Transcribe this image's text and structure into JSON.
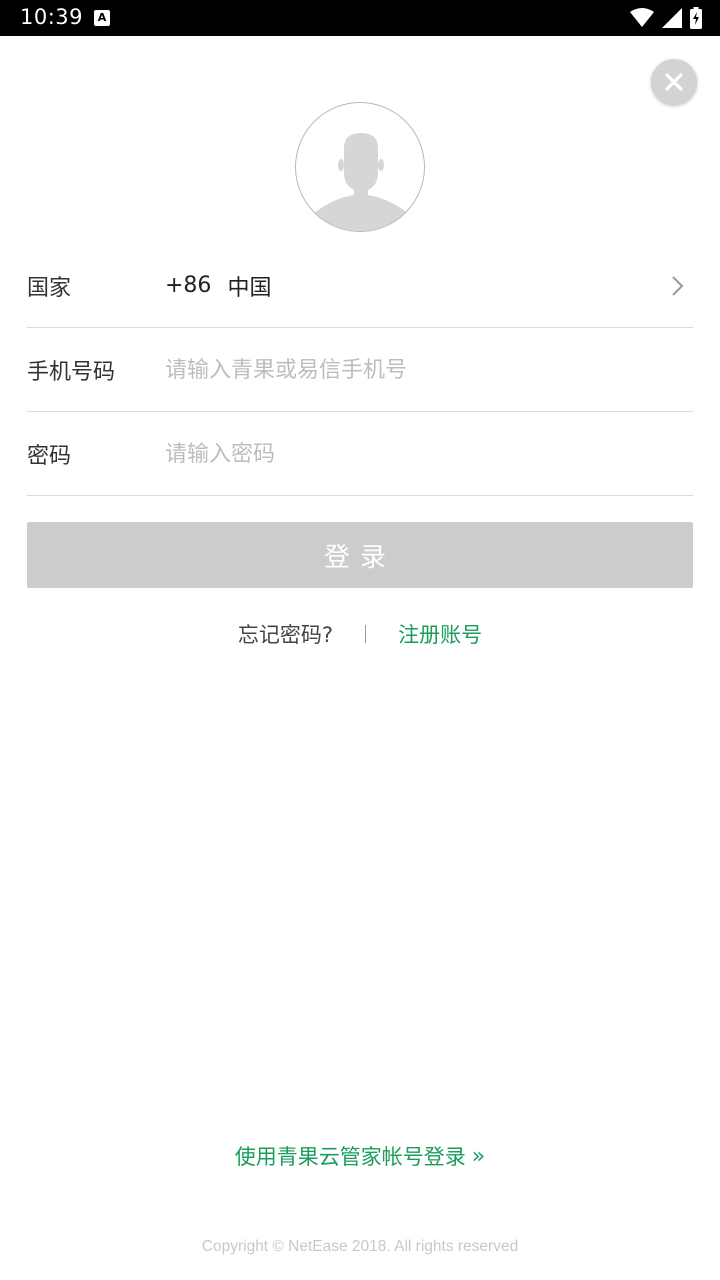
{
  "status_bar": {
    "time": "10:39",
    "app_badge": "A",
    "icons": [
      "wifi-icon",
      "signal-icon",
      "battery-icon"
    ]
  },
  "close_button": {
    "icon": "close-icon"
  },
  "avatar": {
    "icon": "default-avatar-icon"
  },
  "form": {
    "country": {
      "label": "国家",
      "code": "+86",
      "name": "中国",
      "icon": "chevron-right-icon"
    },
    "phone": {
      "label": "手机号码",
      "value": "",
      "placeholder": "请输入青果或易信手机号"
    },
    "password": {
      "label": "密码",
      "value": "",
      "placeholder": "请输入密码"
    }
  },
  "login_button": {
    "label": "登录"
  },
  "links": {
    "forgot_password": "忘记密码?",
    "register": "注册账号"
  },
  "alt_login": {
    "label": "使用青果云管家帐号登录",
    "arrow": "»"
  },
  "footer": {
    "copyright": "Copyright © NetEase 2018. All rights reserved"
  },
  "colors": {
    "accent_green": "#1a9c5b",
    "button_disabled": "#cccccc",
    "placeholder": "#bdbdbd",
    "divider": "#dcdcdc"
  }
}
